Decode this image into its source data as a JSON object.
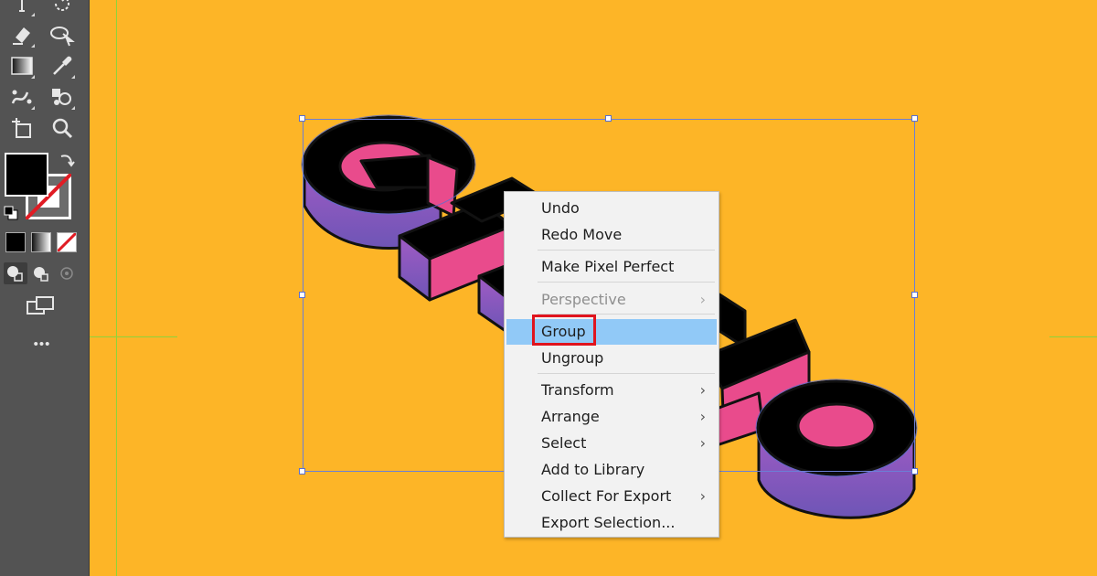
{
  "app": {
    "toolbar": {
      "more_label": "•••"
    },
    "artwork": {
      "colors": {
        "background": "#FDB527",
        "face": "#000000",
        "inner": "#E94B8C",
        "side": "#8657BD",
        "outline": "#3b3b8a"
      }
    },
    "context_menu": {
      "items": [
        {
          "label": "Undo",
          "enabled": true,
          "submenu": false
        },
        {
          "label": "Redo Move",
          "enabled": true,
          "submenu": false
        },
        {
          "label": "Make Pixel Perfect",
          "enabled": true,
          "submenu": false
        },
        {
          "label": "Perspective",
          "enabled": false,
          "submenu": true
        },
        {
          "label": "Group",
          "enabled": true,
          "submenu": false,
          "highlighted": true
        },
        {
          "label": "Ungroup",
          "enabled": true,
          "submenu": false
        },
        {
          "label": "Transform",
          "enabled": true,
          "submenu": true
        },
        {
          "label": "Arrange",
          "enabled": true,
          "submenu": true
        },
        {
          "label": "Select",
          "enabled": true,
          "submenu": true
        },
        {
          "label": "Add to Library",
          "enabled": true,
          "submenu": false
        },
        {
          "label": "Collect For Export",
          "enabled": true,
          "submenu": true
        },
        {
          "label": "Export Selection...",
          "enabled": true,
          "submenu": false
        }
      ],
      "submenu_arrow": "›"
    }
  }
}
